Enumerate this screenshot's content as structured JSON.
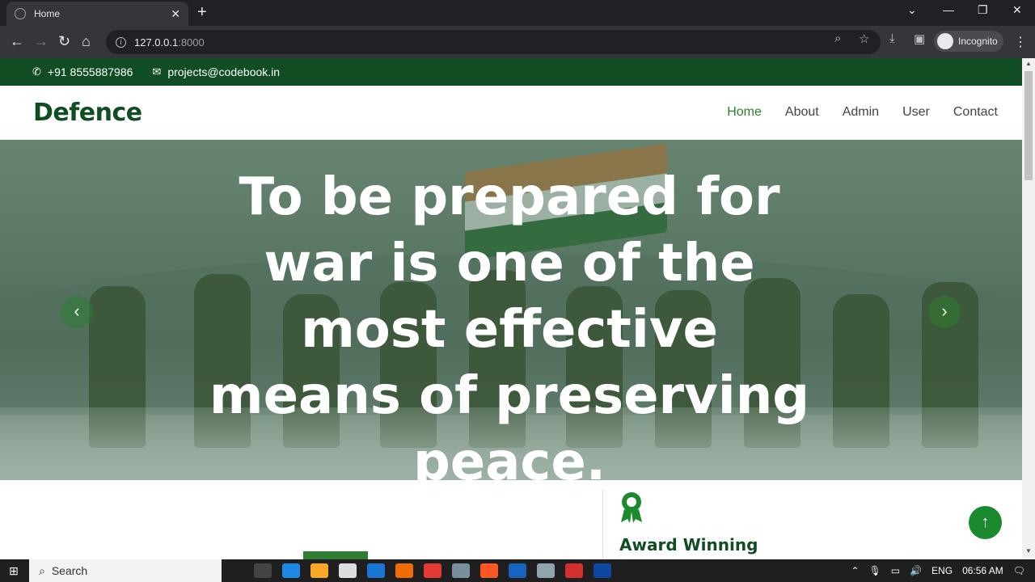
{
  "browser": {
    "tab_title": "Home",
    "tab_close": "✕",
    "new_tab": "+",
    "url_host": "127.0.0.1",
    "url_port": ":8000",
    "profile_label": "Incognito"
  },
  "topbar": {
    "phone": "+91 8555887986",
    "email": "projects@codebook.in"
  },
  "navbar": {
    "brand": "Defence",
    "links": [
      "Home",
      "About",
      "Admin",
      "User",
      "Contact"
    ],
    "active": "Home"
  },
  "hero": {
    "quote": "To be prepared for war is one of the most effective means of preserving peace.",
    "prev_arrow": "‹",
    "next_arrow": "›"
  },
  "feature": {
    "title": "Award Winning"
  },
  "back_to_top": "↑",
  "taskbar": {
    "search_label": "Search",
    "language": "ENG",
    "time": "06:56 AM"
  },
  "colors": {
    "brand_green": "#104d23",
    "accent_green": "#2e7d32"
  }
}
